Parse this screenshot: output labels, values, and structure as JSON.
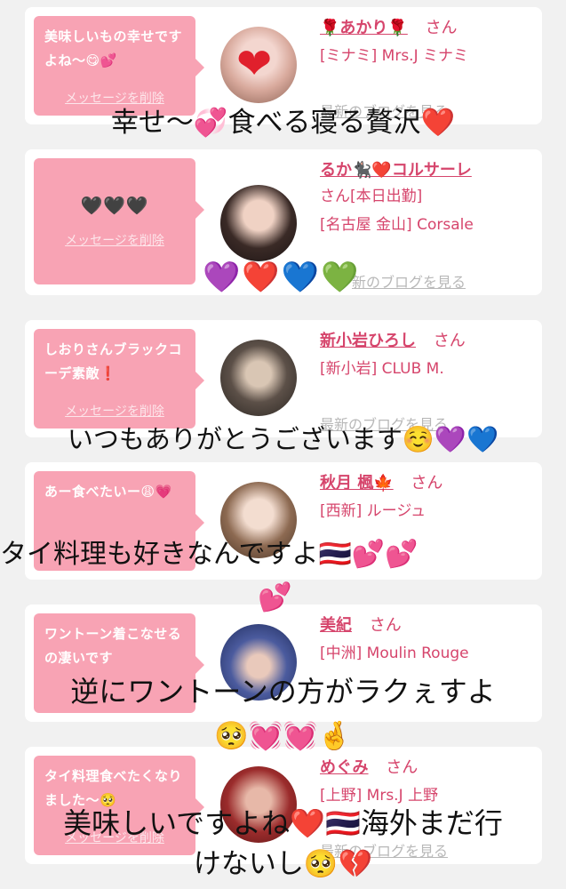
{
  "cards": [
    {
      "message": "美味しいもの幸せですよね〜😋💕",
      "delete_label": "メッセージを削除",
      "name": "🌹あかり🌹",
      "honorific": "さん",
      "shop": "[ミナミ] Mrs.J ミナミ",
      "blog_label": "最新のブログを見る"
    },
    {
      "message": "🖤🖤🖤",
      "delete_label": "メッセージを削除",
      "name": "るか🐈‍⬛❤️コルサーレ",
      "honorific": "さん[本日出勤]",
      "shop": "[名古屋 金山] Corsale",
      "blog_label": "新のブログを見る"
    },
    {
      "message": "しおりさんブラックコーデ素敵❗",
      "delete_label": "メッセージを削除",
      "name": "新小岩ひろし",
      "honorific": "さん",
      "shop": "[新小岩] CLUB M.",
      "blog_label": "最新のブログを見る"
    },
    {
      "message": "あー食べたいー😩💗",
      "delete_label": "",
      "name": "秋月 楓🍁",
      "honorific": "さん",
      "shop": "[西新] ルージュ",
      "blog_label": ""
    },
    {
      "message": "ワントーン着こなせるの凄いです",
      "delete_label": "",
      "name": "美紀",
      "honorific": "さん",
      "shop": "[中洲] Moulin Rouge",
      "blog_label": ""
    },
    {
      "message": "タイ料理食べたくなりました〜🥺",
      "delete_label": "メッセージを削除",
      "name": "めぐみ",
      "honorific": "さん",
      "shop": "[上野] Mrs.J 上野",
      "blog_label": "最新のブログを見る"
    }
  ],
  "overlays": {
    "o1": "幸せ〜💞食べる寝る贅沢❤️",
    "o2": "💜❤️💙💚",
    "o3": "いつもありがとうございます☺️💜💙",
    "o4a": "タイ料理も好きなんですよ🇹🇭💕💕",
    "o4b": "💕",
    "o5a": "逆にワントーンの方がラクぇすよ",
    "o5b": "🥺💓💓🤞",
    "o6a": "美味しいですよね❤️🇹🇭海外まだ行",
    "o6b": "けないし🥺💔"
  },
  "colors": {
    "bubble": "#f8a3b4",
    "accent": "#d6456c"
  }
}
